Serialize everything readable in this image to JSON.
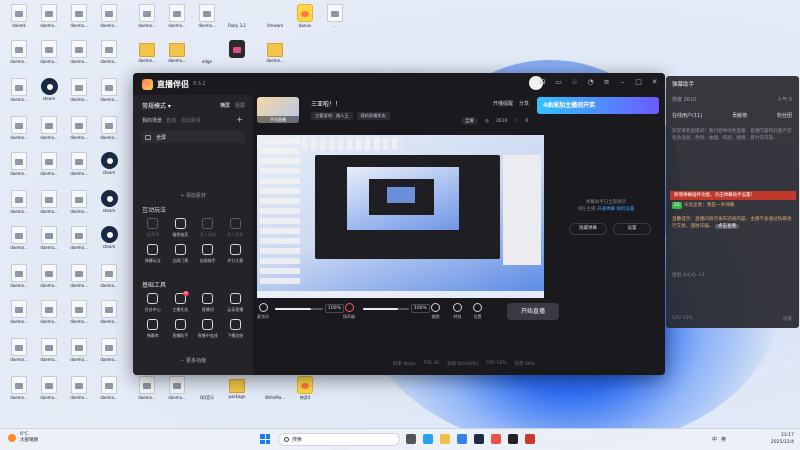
{
  "desktop": {
    "icons": [
      {
        "label": "daemk",
        "kind": "file"
      },
      {
        "label": "daemo...",
        "kind": "file"
      },
      {
        "label": "daemo...",
        "kind": "file"
      },
      {
        "label": "daemo...",
        "kind": "file"
      },
      {
        "label": "daemo...",
        "kind": "file"
      },
      {
        "label": "daemo...",
        "kind": "file"
      },
      {
        "label": "daemo...",
        "kind": "file"
      },
      {
        "label": "Ruby 3.2",
        "kind": "app"
      },
      {
        "label": "Vmware",
        "kind": "app"
      },
      {
        "label": "bonus",
        "kind": "app2"
      },
      {
        "label": "...",
        "kind": "file"
      },
      {
        "label": "daemo...",
        "kind": "file"
      },
      {
        "label": "daemo...",
        "kind": "file"
      },
      {
        "label": "daemo...",
        "kind": "file"
      },
      {
        "label": "daemo...",
        "kind": "file"
      },
      {
        "label": "daemo...",
        "kind": "folder"
      },
      {
        "label": "daemo...",
        "kind": "folder"
      },
      {
        "label": "edge",
        "kind": "app"
      },
      {
        "label": "",
        "kind": "app3"
      },
      {
        "label": "daemo...",
        "kind": "folder"
      },
      {
        "label": "daemo...",
        "kind": "file"
      },
      {
        "label": "steam",
        "kind": "steam"
      },
      {
        "label": "daemo...",
        "kind": "file"
      },
      {
        "label": "daemo...",
        "kind": "file"
      },
      {
        "label": "daemo...",
        "kind": "file"
      },
      {
        "label": "daemo...",
        "kind": "file"
      },
      {
        "label": "daemo...",
        "kind": "file"
      },
      {
        "label": "daemo...",
        "kind": "file"
      },
      {
        "label": "daemo...",
        "kind": "file"
      },
      {
        "label": "daemo...",
        "kind": "file"
      },
      {
        "label": "daemo...",
        "kind": "file"
      },
      {
        "label": "steam",
        "kind": "steam"
      },
      {
        "label": "daemo...",
        "kind": "file"
      },
      {
        "label": "daemo...",
        "kind": "file"
      },
      {
        "label": "daemo...",
        "kind": "file"
      },
      {
        "label": "steam",
        "kind": "steam"
      },
      {
        "label": "daemo...",
        "kind": "file"
      },
      {
        "label": "daemo...",
        "kind": "file"
      },
      {
        "label": "daemo...",
        "kind": "file"
      },
      {
        "label": "steam",
        "kind": "steam"
      },
      {
        "label": "daemo...",
        "kind": "file"
      },
      {
        "label": "daemo...",
        "kind": "file"
      },
      {
        "label": "daemo...",
        "kind": "file"
      },
      {
        "label": "daemo...",
        "kind": "file"
      },
      {
        "label": "daemo...",
        "kind": "file"
      },
      {
        "label": "daemo...",
        "kind": "file"
      },
      {
        "label": "daemo...",
        "kind": "file"
      },
      {
        "label": "daemo...",
        "kind": "file"
      },
      {
        "label": "daemo...",
        "kind": "file"
      },
      {
        "label": "daemo...",
        "kind": "file"
      },
      {
        "label": "daemo...",
        "kind": "file"
      },
      {
        "label": "daemo...",
        "kind": "file"
      },
      {
        "label": "daemo...",
        "kind": "file"
      },
      {
        "label": "daemo...",
        "kind": "file"
      },
      {
        "label": "daemo...",
        "kind": "file"
      },
      {
        "label": "daemo...",
        "kind": "file"
      },
      {
        "label": "daemo...",
        "kind": "file"
      },
      {
        "label": "daemo...",
        "kind": "file"
      },
      {
        "label": "QQ音乐",
        "kind": "app"
      },
      {
        "label": "package",
        "kind": "folder"
      },
      {
        "label": "WriteMa...",
        "kind": "app"
      },
      {
        "label": "神武4",
        "kind": "app2"
      }
    ]
  },
  "app": {
    "title": "直播伴侣",
    "version": "8.5.2",
    "header_icons": [
      "headset-icon",
      "chat-icon",
      "shirt-icon",
      "bell-icon",
      "menu-icon",
      "minimize-icon",
      "maximize-icon",
      "close-icon"
    ]
  },
  "sidebar": {
    "mode": "常规模式 ▾",
    "tabs": [
      {
        "label": "横屏",
        "active": true
      },
      {
        "label": "竖屏",
        "active": false
      }
    ],
    "my_scene": "我的场景",
    "my_scene_sub": "直播 · 添加素材",
    "source_item": "全屏",
    "add_source": "+ 添加素材",
    "interactive_title": "互动玩法",
    "interactive_tools": [
      {
        "label": "连线PK",
        "icon": "pk-icon",
        "enabled": false
      },
      {
        "label": "福袋抽奖",
        "icon": "gift-bag-icon",
        "enabled": true
      },
      {
        "label": "多人连线",
        "icon": "multi-link-icon",
        "enabled": false
      },
      {
        "label": "多人多麦",
        "icon": "multi-mic-icon",
        "enabled": false
      },
      {
        "label": "弹幕玩法",
        "icon": "barrage-icon",
        "enabled": true
      },
      {
        "label": "全屏门票",
        "icon": "ticket-icon",
        "enabled": true
      },
      {
        "label": "自助咖手",
        "icon": "helper-icon",
        "enabled": true
      },
      {
        "label": "评分大赛",
        "icon": "contest-icon",
        "enabled": true
      }
    ],
    "basic_title": "基础工具",
    "basic_tools": [
      {
        "label": "任务中心",
        "icon": "task-icon",
        "badge": ""
      },
      {
        "label": "主播任务",
        "icon": "anchor-task-icon",
        "badge": "8"
      },
      {
        "label": "直播间",
        "icon": "room-icon",
        "badge": ""
      },
      {
        "label": "云录直播",
        "icon": "cloud-record-icon",
        "badge": ""
      },
      {
        "label": "弹幕库",
        "icon": "barrage-lib-icon",
        "badge": ""
      },
      {
        "label": "直播助手",
        "icon": "assistant-icon",
        "badge": ""
      },
      {
        "label": "直播中连线",
        "icon": "link-icon",
        "badge": ""
      },
      {
        "label": "下播总结",
        "icon": "summary-icon",
        "badge": ""
      }
    ],
    "more": "··· 更多功能"
  },
  "main": {
    "banner_return": "手机直播",
    "room_title": "三亚啦！！",
    "room_tags": [
      "主要游戏：路人王",
      "我的直播状态"
    ],
    "live_ops": [
      "开播提醒",
      "分享"
    ],
    "promo_text": "4曲渐加主播冠开奖",
    "stats": {
      "quality": "全屏",
      "heat": "2610",
      "likes": "0"
    },
    "side_tip_line1": "弹幕助手已全部展示",
    "side_tip_line2": "请在主播",
    "side_tip_link1": "开通弹幕",
    "side_tip_link2": "如何设置",
    "side_btn_left": "隐藏弹幕",
    "side_btn_right": "设置"
  },
  "bottombar": {
    "mic_label": "麦克风",
    "mic_volume": "100%",
    "mic_level": 0.75,
    "speaker_label": "扬声器",
    "speaker_volume": "100%",
    "speaker_level": 0.75,
    "beauty_label": "美颜",
    "effects_label": "特效",
    "settings_label": "设置",
    "go_live": "开始直播",
    "status": [
      "码率 0kb/s",
      "FPS 30",
      "丢帧 0(0.00%)",
      "CPU 12%",
      "内存 56%"
    ]
  },
  "assistant": {
    "title": "弹幕助手",
    "meta_left": "热度 2610",
    "meta_right": "人气 0",
    "tabs": [
      "在线用户(11)",
      "贡献榜",
      "粉丝团"
    ],
    "system_msg": "欢迎来到直播间！我们倡导绿色直播，直播内容和封面严禁包含低俗、色情、抽烟、喝酒、赌博、暴力等内容。",
    "alert": "新增弹幕插件功能，点击弹幕助手设置！",
    "level": "22",
    "user_msg": "天盐呈耍：我是一条弹幕",
    "tip_msg": "温馨提示：直播间请勿发布违规内容，主播不会通过私聊进行交易，谨防诈骗。",
    "tip_link": "点击查看",
    "gift_msg": "送出 小心心 ×1",
    "foot_left": "CPU 12%",
    "foot_right": "隐藏"
  },
  "taskbar": {
    "weather_temp": "6°C",
    "weather_desc": "大部晴朗",
    "search_placeholder": "搜索",
    "time": "23:17",
    "date": "2025/12/4",
    "tray": [
      "中",
      "英"
    ]
  }
}
